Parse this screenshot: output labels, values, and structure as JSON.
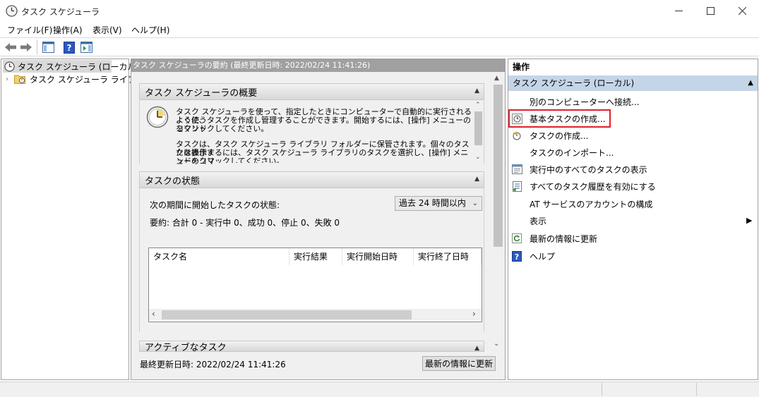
{
  "window": {
    "title": "タスク スケジューラ"
  },
  "menu": [
    "ファイル(F)",
    "操作(A)",
    "表示(V)",
    "ヘルプ(H)"
  ],
  "tree": {
    "root": "タスク スケジューラ (ローカル)",
    "library": "タスク スケジューラ ライブラリ"
  },
  "center": {
    "header": "タスク スケジューラの要約 (最終更新日時: 2022/02/24 11:41:26)",
    "overview": {
      "title": "タスク スケジューラの概要",
      "para1_line1": "タスク スケジューラを使って、指定したときにコンピューターで自動的に実行されるように、",
      "para1_line2": "よく使うタスクを作成し管理することができます。開始するには、[操作] メニューのコマンド",
      "para1_line3": "をクリックしてください。",
      "para2_line1": "タスクは、タスク スケジューラ ライブラリ フォルダーに保管されます。個々のタスクを表示ま",
      "para2_line2": "たは操作するには、タスク スケジューラ ライブラリのタスクを選択し、[操作] メニューのコマ",
      "para2_line3": "ンドをクリックしてください。"
    },
    "status": {
      "title": "タスクの状態",
      "label": "次の期間に開始したタスクの状態:",
      "period": "過去 24 時間以内",
      "summary": "要約: 合計 0 - 実行中 0、成功 0、停止 0、失敗 0",
      "columns": [
        "タスク名",
        "実行結果",
        "実行開始日時",
        "実行終了日時"
      ]
    },
    "active": {
      "title": "アクティブなタスク"
    },
    "last_updated": "最終更新日時: 2022/02/24 11:41:26",
    "refresh_button": "最新の情報に更新"
  },
  "actions": {
    "title": "操作",
    "group": "タスク スケジューラ (ローカル)",
    "items": [
      {
        "label": "別のコンピューターへ接続...",
        "icon": "none"
      },
      {
        "label": "基本タスクの作成...",
        "icon": "basic-task-icon"
      },
      {
        "label": "タスクの作成...",
        "icon": "create-task-icon"
      },
      {
        "label": "タスクのインポート...",
        "icon": "none"
      },
      {
        "label": "実行中のすべてのタスクの表示",
        "icon": "running-tasks-icon"
      },
      {
        "label": "すべてのタスク履歴を有効にする",
        "icon": "history-icon"
      },
      {
        "label": "AT サービスのアカウントの構成",
        "icon": "none"
      },
      {
        "label": "表示",
        "icon": "none"
      },
      {
        "label": "最新の情報に更新",
        "icon": "refresh-icon"
      },
      {
        "label": "ヘルプ",
        "icon": "help-icon"
      }
    ]
  }
}
